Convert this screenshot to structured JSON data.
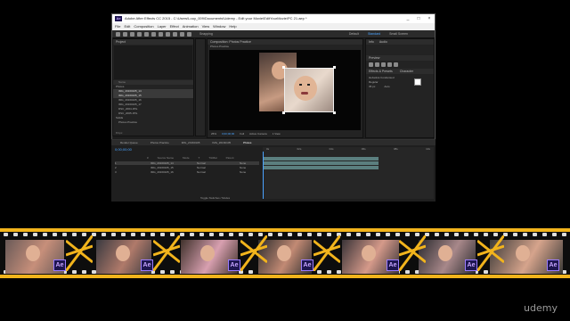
{
  "window": {
    "title": "Adobe After Effects CC 2015 - C:\\Users\\Louy_009\\Documents\\Udemy - Edit your Movie\\EditYourMovie\\PC 21.aep *",
    "app_logo": "Ae",
    "controls": [
      "_",
      "□",
      "×"
    ]
  },
  "menu": [
    "File",
    "Edit",
    "Composition",
    "Layer",
    "Effect",
    "Animation",
    "View",
    "Window",
    "Help"
  ],
  "toolbar": {
    "snapping": "Snapping",
    "workspaces": [
      "Default",
      "Standard",
      "Small Screen"
    ],
    "search_placeholder": "Search Help"
  },
  "project": {
    "tab": "Project",
    "rows": [
      {
        "label": "Name",
        "kind": "header"
      },
      {
        "label": "Photos",
        "kind": "folder"
      },
      {
        "label": "IMG_20160105_14",
        "kind": "item",
        "selected": true
      },
      {
        "label": "IMG_20160105_15",
        "kind": "item",
        "selected": true
      },
      {
        "label": "IMG_20160105_16",
        "kind": "item",
        "selected": false
      },
      {
        "label": "IMG_20160105_17",
        "kind": "item",
        "selected": false
      },
      {
        "label": "DSC_2004.JPG",
        "kind": "item",
        "selected": false
      },
      {
        "label": "DSC_2005.JPG",
        "kind": "item",
        "selected": false
      },
      {
        "label": "Solids",
        "kind": "folder"
      },
      {
        "label": "Photos Practice",
        "kind": "comp"
      }
    ],
    "bpc": "8 bpc"
  },
  "composition": {
    "tab": "Composition: Photos Practice",
    "sub_tab": "Photos Practice",
    "zoom": "25%",
    "time": "0;00;00;00",
    "resolution": "Full",
    "camera": "Active Camera",
    "views": "1 View"
  },
  "right_panels": {
    "info_tab": "Info",
    "audio_tab": "Audio",
    "preview_tab": "Preview",
    "effects_tab": "Effects & Presets",
    "character_tab": "Character",
    "font": "Helvetica Condensed",
    "style": "Regular",
    "font_size": "35 px",
    "leading": "Auto",
    "paragraph_tab": "Paragraph",
    "align_tab": "Align"
  },
  "timeline": {
    "tabs": [
      "Render Queue",
      "Photos Practice",
      "IMG_20160105",
      "IMG_20160105",
      "Photos"
    ],
    "timecode": "0;00;00;00",
    "columns": [
      "#",
      "Source Name",
      "Mode",
      "T",
      "TrkMat",
      "Parent"
    ],
    "layers": [
      {
        "num": "1",
        "name": "IMG_20160105_14",
        "mode": "Normal",
        "parent": "None"
      },
      {
        "num": "2",
        "name": "IMG_20160105_15",
        "mode": "Normal",
        "parent": "None"
      },
      {
        "num": "3",
        "name": "IMG_20160105_16",
        "mode": "Normal",
        "parent": "None"
      }
    ],
    "ruler": [
      "0s",
      "02s",
      "04s",
      "06s",
      "08s",
      "10s"
    ],
    "footer": "Toggle Switches / Modes"
  },
  "watermark": "udemy",
  "film_badge": "Ae",
  "colors": {
    "strip_accent": "#f2b41c",
    "selection": "#4aa3ff",
    "layer_green": "#5b7f7f",
    "ae_purple": "#1e1650"
  }
}
